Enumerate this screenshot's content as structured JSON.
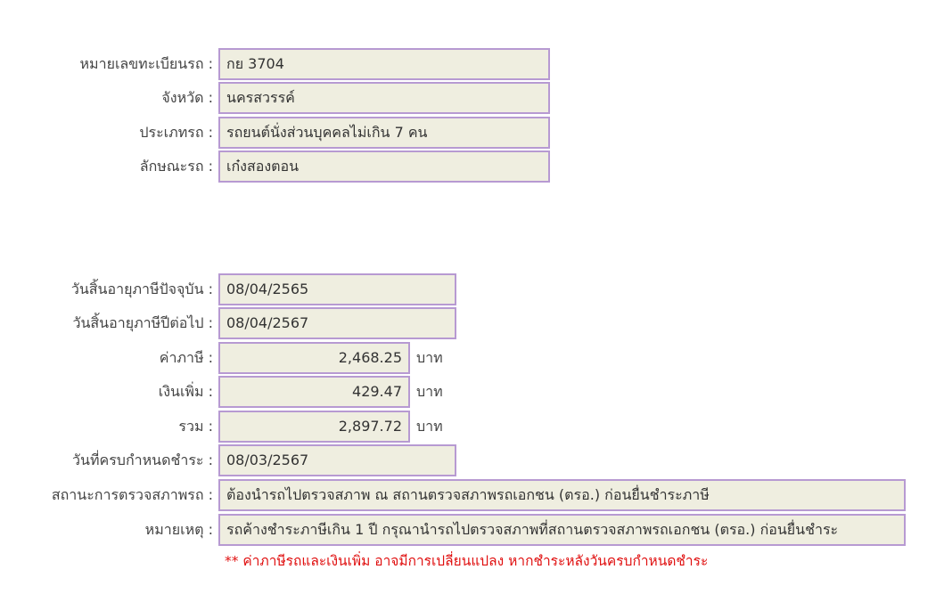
{
  "vehicle": {
    "plate": {
      "label": "หมายเลขทะเบียนรถ :",
      "value": "กย 3704"
    },
    "province": {
      "label": "จังหวัด :",
      "value": "นครสวรรค์"
    },
    "type": {
      "label": "ประเภทรถ :",
      "value": "รถยนต์นั่งส่วนบุคคลไม่เกิน 7 คน"
    },
    "body": {
      "label": "ลักษณะรถ :",
      "value": "เก๋งสองตอน"
    }
  },
  "tax": {
    "current_expiry": {
      "label": "วันสิ้นอายุภาษีปัจจุบัน :",
      "value": "08/04/2565"
    },
    "next_expiry": {
      "label": "วันสิ้นอายุภาษีปีต่อไป :",
      "value": "08/04/2567"
    },
    "tax_amount": {
      "label": "ค่าภาษี :",
      "value": "2,468.25",
      "unit": "บาท"
    },
    "surcharge": {
      "label": "เงินเพิ่ม :",
      "value": "429.47",
      "unit": "บาท"
    },
    "total": {
      "label": "รวม :",
      "value": "2,897.72",
      "unit": "บาท"
    },
    "due_date": {
      "label": "วันที่ครบกำหนดชำระ :",
      "value": "08/03/2567"
    },
    "inspection_status": {
      "label": "สถานะการตรวจสภาพรถ :",
      "value": "ต้องนำรถไปตรวจสภาพ ณ สถานตรวจสภาพรถเอกชน (ตรอ.) ก่อนยื่นชำระภาษี"
    },
    "remark": {
      "label": "หมายเหตุ :",
      "value": "รถค้างชำระภาษีเกิน 1 ปี กรุณานำรถไปตรวจสภาพที่สถานตรวจสภาพรถเอกชน (ตรอ.) ก่อนยื่นชำระ"
    }
  },
  "warning": "** ค่าภาษีรถและเงินเพิ่ม อาจมีการเปลี่ยนแปลง หากชำระหลังวันครบกำหนดชำระ",
  "colors": {
    "field_background": "#efeee0",
    "field_border": "#b79ad2",
    "warning_text": "#e01010"
  }
}
